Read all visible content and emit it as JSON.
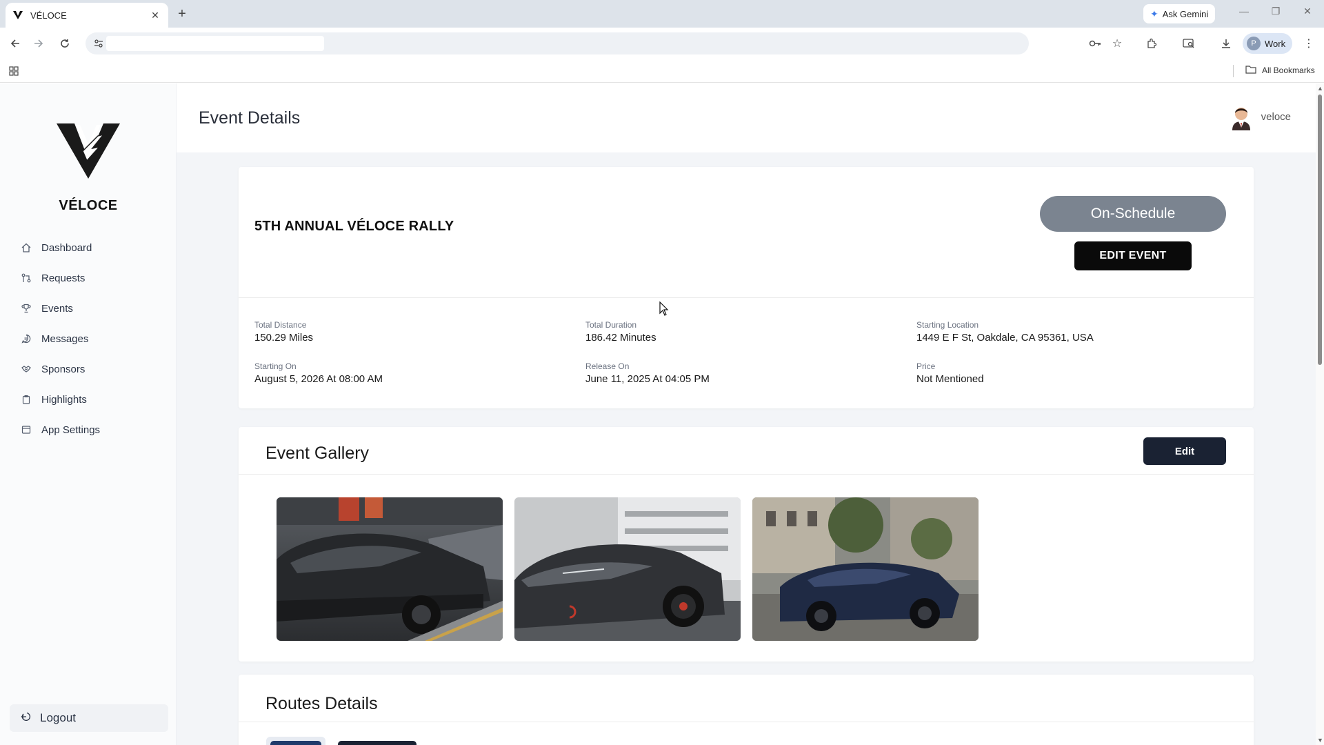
{
  "browser": {
    "tab_title": "VÉLOCE",
    "new_tab": "+",
    "tab_close": "✕",
    "ask_gemini": "Ask Gemini",
    "url": "",
    "profile_initial": "P",
    "profile_label": "Work",
    "all_bookmarks": "All Bookmarks"
  },
  "sidebar": {
    "brand": "VÉLOCE",
    "items": [
      {
        "label": "Dashboard",
        "icon": "home-icon"
      },
      {
        "label": "Requests",
        "icon": "requests-icon"
      },
      {
        "label": "Events",
        "icon": "trophy-icon"
      },
      {
        "label": "Messages",
        "icon": "message-icon"
      },
      {
        "label": "Sponsors",
        "icon": "handshake-icon"
      },
      {
        "label": "Highlights",
        "icon": "clipboard-icon"
      },
      {
        "label": "App Settings",
        "icon": "settings-icon"
      }
    ],
    "logout": "Logout"
  },
  "header": {
    "title": "Event Details",
    "username": "veloce"
  },
  "event": {
    "name": "5TH ANNUAL VÉLOCE RALLY",
    "status": "On-Schedule",
    "edit_label": "EDIT EVENT",
    "details": [
      {
        "label": "Total Distance",
        "value": "150.29 Miles"
      },
      {
        "label": "Total Duration",
        "value": "186.42 Minutes"
      },
      {
        "label": "Starting Location",
        "value": "1449 E F St, Oakdale, CA 95361, USA"
      },
      {
        "label": "Starting On",
        "value": "August 5, 2026 At 08:00 AM"
      },
      {
        "label": "Release On",
        "value": "June 11, 2025 At 04:05 PM"
      },
      {
        "label": "Price",
        "value": "Not Mentioned"
      }
    ]
  },
  "gallery": {
    "title": "Event Gallery",
    "edit_label": "Edit"
  },
  "routes": {
    "title": "Routes Details"
  },
  "colors": {
    "status_pill": "#7b8490",
    "primary_dark": "#0a0a0a",
    "button_navy": "#1a2233"
  }
}
